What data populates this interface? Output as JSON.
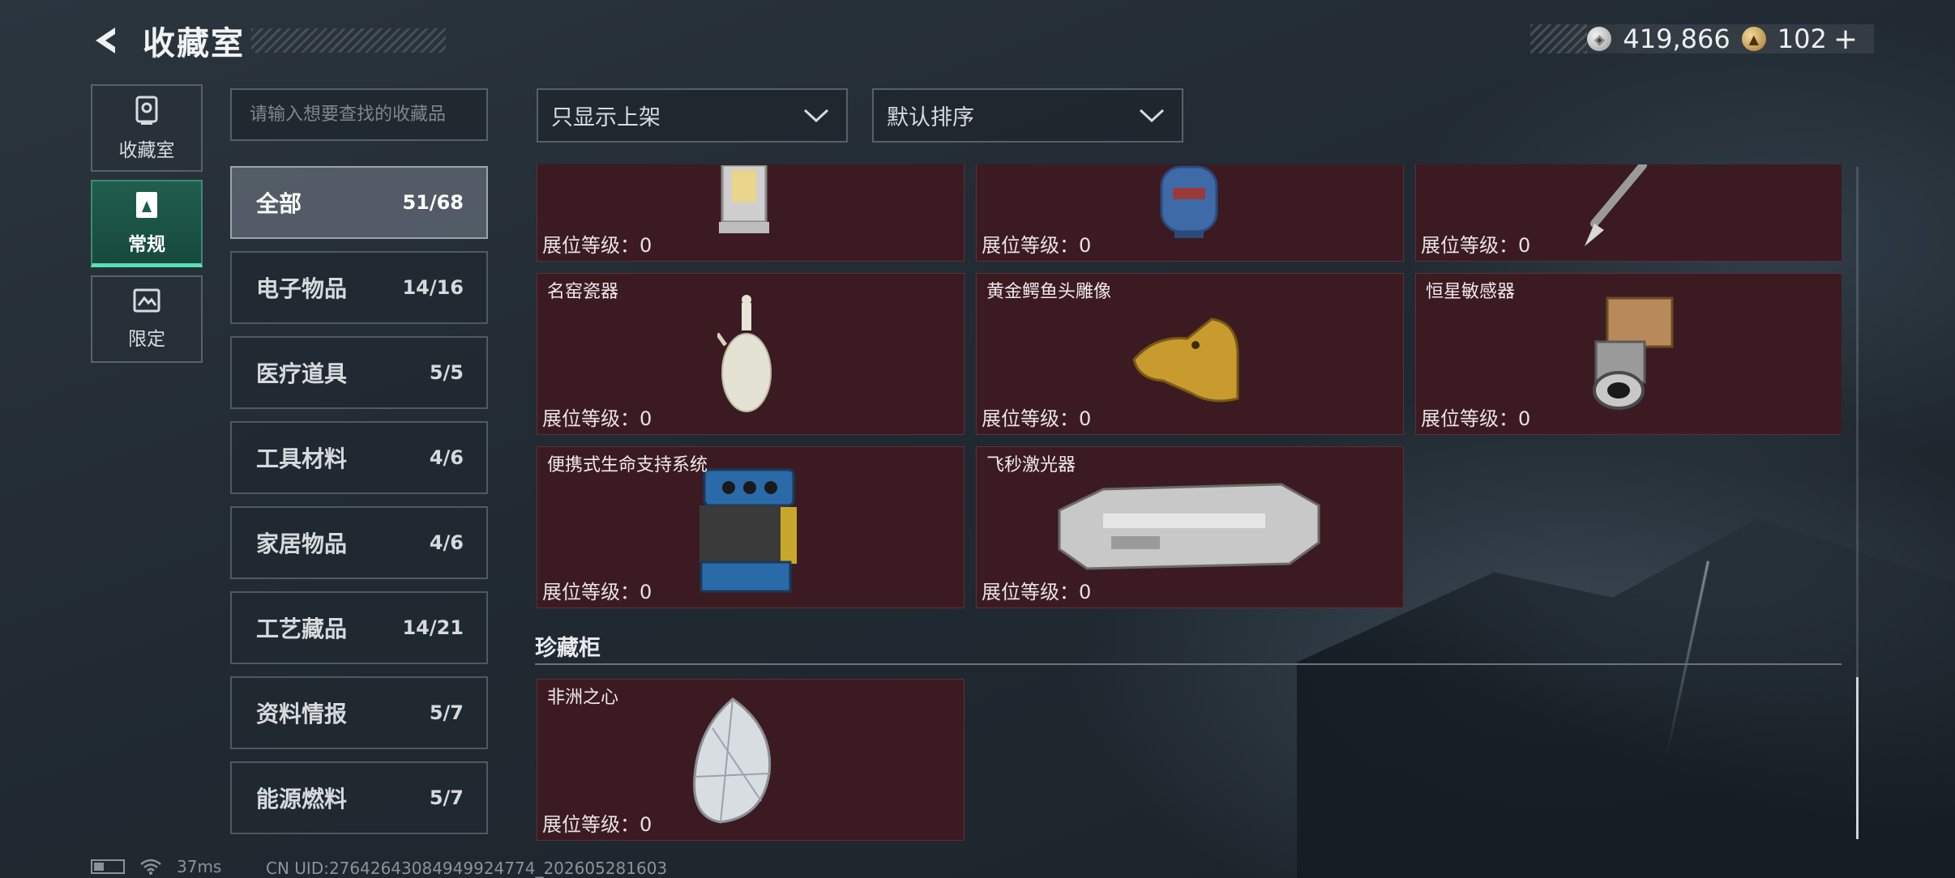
{
  "header": {
    "title": "收藏室"
  },
  "currency": {
    "silver": "419,866",
    "gold": "102",
    "plus": "+"
  },
  "rail": [
    {
      "label": "收藏室",
      "icon": "trophy-icon",
      "active": false
    },
    {
      "label": "常规",
      "icon": "collection-icon",
      "active": true
    },
    {
      "label": "限定",
      "icon": "limited-icon",
      "active": false
    }
  ],
  "search": {
    "placeholder": "请输入想要查找的收藏品"
  },
  "categories": [
    {
      "name": "全部",
      "count": "51/68",
      "active": true
    },
    {
      "name": "电子物品",
      "count": "14/16"
    },
    {
      "name": "医疗道具",
      "count": "5/5"
    },
    {
      "name": "工具材料",
      "count": "4/6"
    },
    {
      "name": "家居物品",
      "count": "4/6"
    },
    {
      "name": "工艺藏品",
      "count": "14/21"
    },
    {
      "name": "资料情报",
      "count": "5/7"
    },
    {
      "name": "能源燃料",
      "count": "5/7"
    }
  ],
  "filters": {
    "shelf": "只显示上架",
    "sort": "默认排序"
  },
  "items": [
    {
      "name": "",
      "level": "展位等级：0",
      "icon": "lantern-icon"
    },
    {
      "name": "",
      "level": "展位等级：0",
      "icon": "gas-tank-icon"
    },
    {
      "name": "",
      "level": "展位等级：0",
      "icon": "fountain-pen-icon"
    },
    {
      "name": "名窑瓷器",
      "level": "展位等级：0",
      "icon": "porcelain-vase-icon"
    },
    {
      "name": "黄金鳄鱼头雕像",
      "level": "展位等级：0",
      "icon": "golden-crocodile-icon"
    },
    {
      "name": "恒星敏感器",
      "level": "展位等级：0",
      "icon": "star-sensor-icon"
    },
    {
      "name": "便携式生命支持系统",
      "level": "展位等级：0",
      "icon": "life-support-icon"
    },
    {
      "name": "飞秒激光器",
      "level": "展位等级：0",
      "icon": "laser-device-icon"
    }
  ],
  "treasure": {
    "title": "珍藏柜",
    "items": [
      {
        "name": "非洲之心",
        "level": "展位等级：0",
        "icon": "diamond-icon"
      }
    ]
  },
  "status": {
    "ping": "37ms",
    "uid": "CN UID:27642643084949924774_202605281603"
  }
}
